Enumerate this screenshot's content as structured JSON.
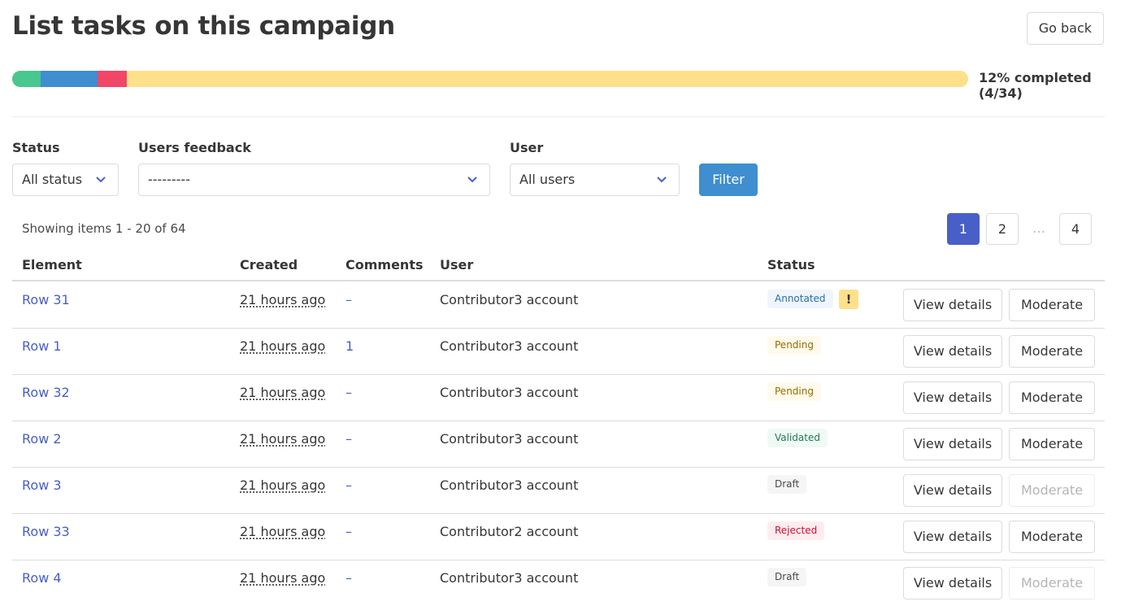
{
  "page": {
    "title": "List tasks on this campaign",
    "go_back_label": "Go back"
  },
  "progress": {
    "label": "12% completed (4/34)",
    "segments": [
      {
        "status": "validated",
        "fraction": 0.0298,
        "color": "#48c78e"
      },
      {
        "status": "annotated",
        "fraction": 0.0596,
        "color": "#3e8ed0"
      },
      {
        "status": "rejected",
        "fraction": 0.0306,
        "color": "#f14668"
      },
      {
        "status": "pending",
        "fraction": 0.88,
        "color": "#ffe08a"
      }
    ]
  },
  "filters": {
    "status": {
      "label": "Status",
      "value": "All status"
    },
    "feedback": {
      "label": "Users feedback",
      "value": "---------"
    },
    "user": {
      "label": "User",
      "value": "All users"
    },
    "filter_button": "Filter"
  },
  "showing": "Showing items 1 - 20 of 64",
  "pagination": {
    "pages": [
      "1",
      "2",
      "…",
      "4"
    ],
    "current": "1"
  },
  "table": {
    "headers": {
      "element": "Element",
      "created": "Created",
      "comments": "Comments",
      "user": "User",
      "status": "Status"
    },
    "view_label": "View details",
    "moderate_label": "Moderate",
    "rows": [
      {
        "element": "Row 31",
        "created": "21 hours ago",
        "comments": "–",
        "user": "Contributor3 account",
        "status": "Annotated",
        "status_class": "annotated",
        "warning": "!",
        "moderate_enabled": true
      },
      {
        "element": "Row 1",
        "created": "21 hours ago",
        "comments": "1",
        "user": "Contributor3 account",
        "status": "Pending",
        "status_class": "pending",
        "warning": "",
        "moderate_enabled": true
      },
      {
        "element": "Row 32",
        "created": "21 hours ago",
        "comments": "–",
        "user": "Contributor3 account",
        "status": "Pending",
        "status_class": "pending",
        "warning": "",
        "moderate_enabled": true
      },
      {
        "element": "Row 2",
        "created": "21 hours ago",
        "comments": "–",
        "user": "Contributor3 account",
        "status": "Validated",
        "status_class": "validated",
        "warning": "",
        "moderate_enabled": true
      },
      {
        "element": "Row 3",
        "created": "21 hours ago",
        "comments": "–",
        "user": "Contributor3 account",
        "status": "Draft",
        "status_class": "draft",
        "warning": "",
        "moderate_enabled": false
      },
      {
        "element": "Row 33",
        "created": "21 hours ago",
        "comments": "–",
        "user": "Contributor2 account",
        "status": "Rejected",
        "status_class": "rejected",
        "warning": "",
        "moderate_enabled": true
      },
      {
        "element": "Row 4",
        "created": "21 hours ago",
        "comments": "–",
        "user": "Contributor3 account",
        "status": "Draft",
        "status_class": "draft",
        "warning": "",
        "moderate_enabled": false
      }
    ]
  }
}
